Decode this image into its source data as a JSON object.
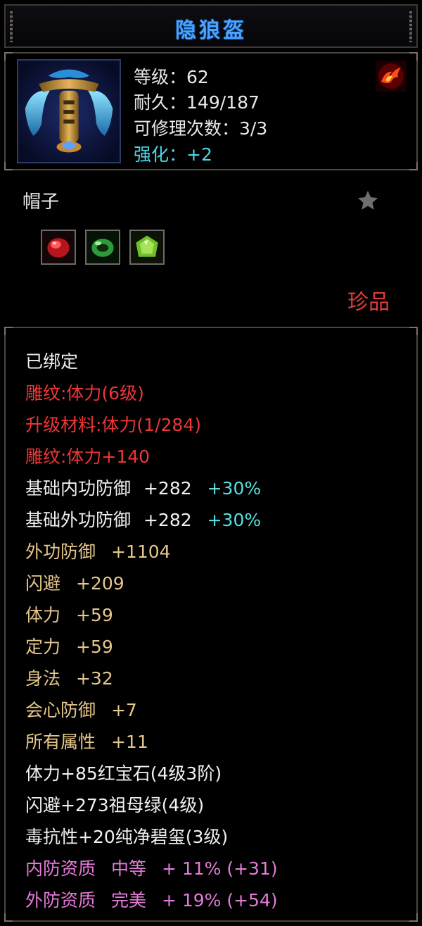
{
  "item": {
    "name": "隐狼盔",
    "level_label": "等级",
    "level_value": "62",
    "durability_label": "耐久",
    "durability_value": "149/187",
    "repair_label": "可修理次数",
    "repair_value": "3/3",
    "enhance_label": "强化",
    "enhance_value": "+2",
    "separator": "：",
    "type": "帽子",
    "quality": "珍品",
    "icons": {
      "item": "winged-helmet-icon",
      "element": "fire-phoenix-icon",
      "favorite": "star-icon",
      "gems": [
        "ruby-gem-icon",
        "emerald-ring-icon",
        "jade-gem-icon"
      ]
    }
  },
  "attributes": {
    "bound": "已绑定",
    "engrave": "雕纹:体力(6级)",
    "upgrade_material": "升级材料:体力(1/284)",
    "engrave_bonus": "雕纹:体力+140",
    "base_inner_def": {
      "label": "基础内功防御",
      "value": "+282",
      "bonus": "+30%"
    },
    "base_outer_def": {
      "label": "基础外功防御",
      "value": "+282",
      "bonus": "+30%"
    },
    "outer_def": {
      "label": "外功防御",
      "value": "+1104"
    },
    "dodge": {
      "label": "闪避",
      "value": "+209"
    },
    "stamina": {
      "label": "体力",
      "value": "+59"
    },
    "focus": {
      "label": "定力",
      "value": "+59"
    },
    "agility": {
      "label": "身法",
      "value": "+32"
    },
    "crit_def": {
      "label": "会心防御",
      "value": "+7"
    },
    "all_attr": {
      "label": "所有属性",
      "value": "+11"
    },
    "gem_lines": [
      "体力+85红宝石(4级3阶)",
      "闪避+273祖母绿(4级)",
      "毒抗性+20纯净碧玺(3级)"
    ],
    "inner_quality": {
      "label": "内防资质",
      "grade": "中等",
      "value": "+ 11% (+31)"
    },
    "outer_quality": {
      "label": "外防资质",
      "grade": "完美",
      "value": "+ 19% (+54)"
    }
  },
  "colors": {
    "title": "#4aa3ff",
    "red_text": "#ee3636",
    "gold_text": "#e6c78a",
    "pink_text": "#e57bd8",
    "cyan_text": "#55e0e0"
  }
}
